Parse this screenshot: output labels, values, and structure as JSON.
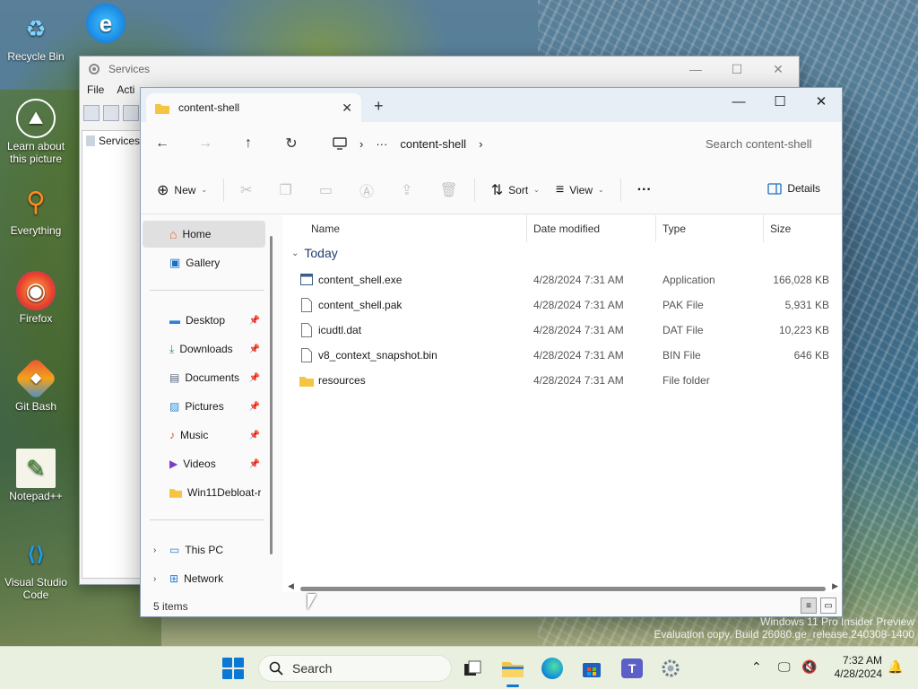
{
  "desktop": {
    "icons": [
      {
        "label": "Recycle Bin",
        "glyph": "♻"
      },
      {
        "label": "",
        "glyph": "e"
      },
      {
        "label": "Learn about this picture",
        "glyph": "⛰"
      },
      {
        "label": "Everything",
        "glyph": "⚲"
      },
      {
        "label": "Firefox",
        "glyph": "◉"
      },
      {
        "label": "Git Bash",
        "glyph": "◆"
      },
      {
        "label": "Notepad++",
        "glyph": "✎"
      },
      {
        "label": "Visual Studio Code",
        "glyph": "⟨⟩"
      }
    ],
    "watermark_line1": "Windows 11 Pro Insider Preview",
    "watermark_line2": "Evaluation copy. Build 26080.ge_release.240308-1400"
  },
  "services_window": {
    "title": "Services",
    "menu": [
      "File",
      "Acti"
    ],
    "tree_root": "Services"
  },
  "explorer": {
    "tab_title": "content-shell",
    "tab_close": "✕",
    "new_tab": "+",
    "window_controls": {
      "minimize": "—",
      "maximize": "☐",
      "close": "✕"
    },
    "nav": {
      "back": "←",
      "forward": "→",
      "up": "↑",
      "refresh": "↻"
    },
    "address": {
      "ellipsis": "···",
      "crumb": "content-shell",
      "chevron": "›"
    },
    "search_placeholder": "Search content-shell",
    "commands": {
      "new": "New",
      "sort": "Sort",
      "view": "View",
      "more": "···",
      "details": "Details"
    },
    "nav_pane": {
      "home": "Home",
      "gallery": "Gallery",
      "quick": [
        {
          "label": "Desktop",
          "icon": "desktop-icon"
        },
        {
          "label": "Downloads",
          "icon": "download-icon"
        },
        {
          "label": "Documents",
          "icon": "documents-icon"
        },
        {
          "label": "Pictures",
          "icon": "pictures-icon"
        },
        {
          "label": "Music",
          "icon": "music-icon"
        },
        {
          "label": "Videos",
          "icon": "videos-icon"
        },
        {
          "label": "Win11Debloat-r",
          "icon": "folder-icon"
        }
      ],
      "this_pc": "This PC",
      "network": "Network"
    },
    "columns": {
      "name": "Name",
      "date": "Date modified",
      "type": "Type",
      "size": "Size"
    },
    "group_label": "Today",
    "files": [
      {
        "name": "content_shell.exe",
        "date": "4/28/2024 7:31 AM",
        "type": "Application",
        "size": "166,028 KB",
        "kind": "exe"
      },
      {
        "name": "content_shell.pak",
        "date": "4/28/2024 7:31 AM",
        "type": "PAK File",
        "size": "5,931 KB",
        "kind": "file"
      },
      {
        "name": "icudtl.dat",
        "date": "4/28/2024 7:31 AM",
        "type": "DAT File",
        "size": "10,223 KB",
        "kind": "file"
      },
      {
        "name": "v8_context_snapshot.bin",
        "date": "4/28/2024 7:31 AM",
        "type": "BIN File",
        "size": "646 KB",
        "kind": "file"
      },
      {
        "name": "resources",
        "date": "4/28/2024 7:31 AM",
        "type": "File folder",
        "size": "",
        "kind": "folder"
      }
    ],
    "status": "5 items"
  },
  "taskbar": {
    "search_label": "Search",
    "time": "7:32 AM",
    "date": "4/28/2024"
  },
  "colors": {
    "accent": "#0a78d4",
    "folder": "#f5c542"
  }
}
